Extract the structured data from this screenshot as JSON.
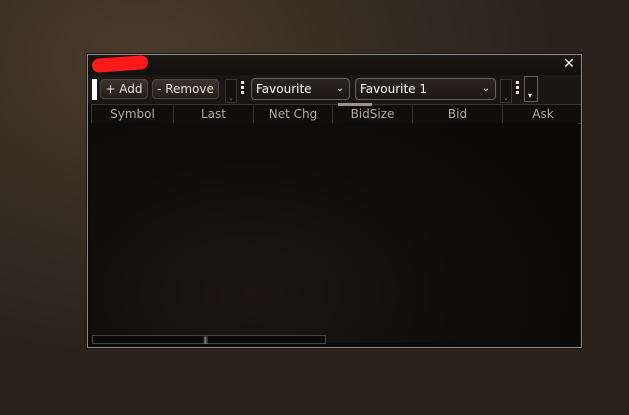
{
  "window": {
    "close_glyph": "✕"
  },
  "toolbar": {
    "add_label": "+ Add",
    "remove_label": "- Remove",
    "group_select": {
      "value": "Favourite"
    },
    "list_select": {
      "value": "Favourite 1"
    },
    "chevron_glyph": "⌄",
    "dropdown_glyph": "▾"
  },
  "grid": {
    "columns": [
      "Symbol",
      "Last",
      "Net Chg",
      "BidSize",
      "Bid",
      "Ask"
    ]
  },
  "scrollbar": {
    "grip_glyph": "|||"
  },
  "colors": {
    "accent_red": "#ff1a1a",
    "background": "#0d0b09",
    "border": "#8c8c8c"
  }
}
